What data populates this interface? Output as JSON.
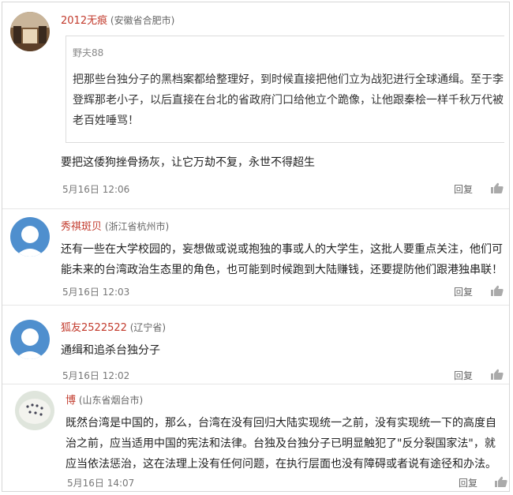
{
  "comments": [
    {
      "user": "2012无痕",
      "location": "(安徽省合肥市)",
      "quote": {
        "author": "野夫88",
        "text": "把那些台独分子的黑档案都给整理好，到时候直接把他们立为战犯进行全球通缉。至于李登辉那老小子，以后直接在台北的省政府门口给他立个跪像，让他跟秦桧一样千秋万代被老百姓唾骂！"
      },
      "text": "要把这倭狗挫骨扬灰，让它万劫不复，永世不得超生",
      "time": "5月16日 12:06",
      "reply": "回复"
    },
    {
      "user": "秀祺斑贝",
      "location": "(浙江省杭州市)",
      "text": "还有一些在大学校园的，妄想做或说或抱独的事或人的大学生，这批人要重点关注，他们可能未来的台湾政治生态里的角色，也可能到时候跑到大陆赚钱，还要提防他们跟港独串联！",
      "time": "5月16日 12:03",
      "reply": "回复"
    },
    {
      "user": "狐友2522522",
      "location": "(辽宁省)",
      "text": "通缉和追杀台独分子",
      "time": "5月16日 12:02",
      "reply": "回复"
    },
    {
      "user": "博",
      "location": "(山东省烟台市)",
      "text": "既然台湾是中国的，那么，台湾在没有回归大陆实现统一之前，没有实现统一下的高度自治之前，应当适用中国的宪法和法律。台独及台独分子已明显触犯了\"反分裂国家法\"，就应当依法惩治，这在法理上没有任何问题，在执行层面也没有障碍或者说有途径和办法。",
      "time": "5月16日 14:07",
      "reply": "回复"
    }
  ]
}
